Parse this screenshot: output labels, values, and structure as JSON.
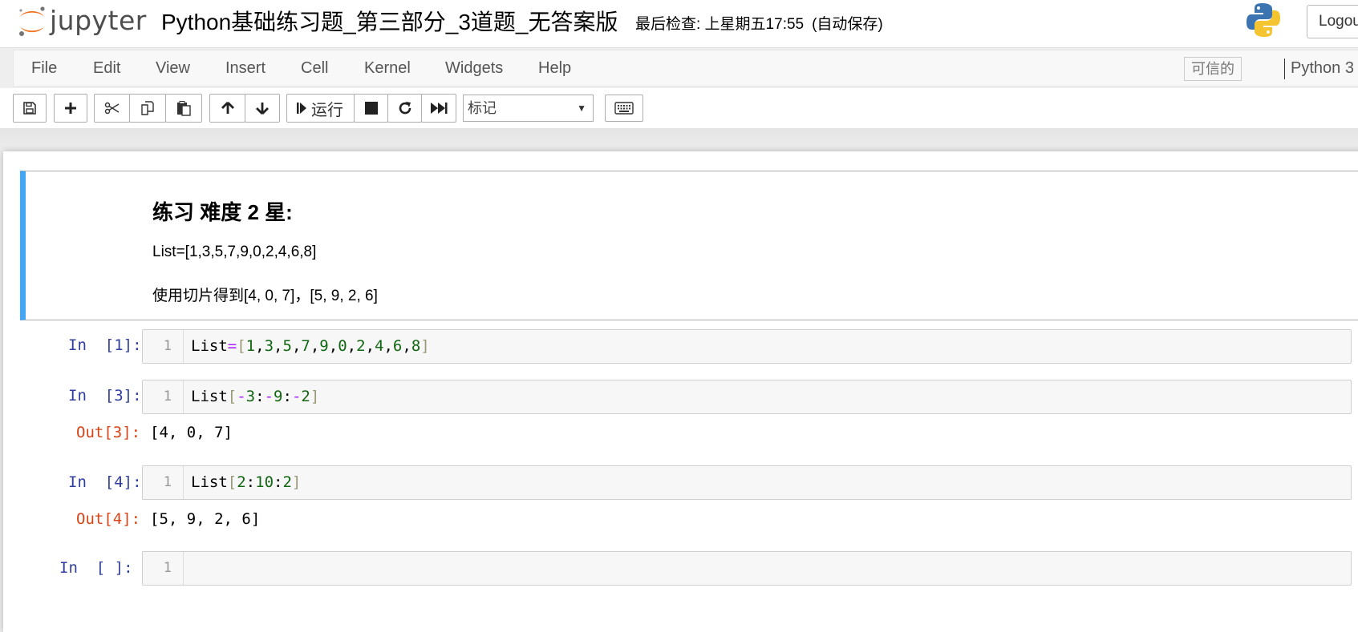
{
  "header": {
    "logo_text": "jupyter",
    "notebook_title": "Python基础练习题_第三部分_3道题_无答案版",
    "checkpoint": "最后检查: 上星期五17:55",
    "autosave": "(自动保存)",
    "logout_label": "Logout"
  },
  "menubar": {
    "items": [
      "File",
      "Edit",
      "View",
      "Insert",
      "Cell",
      "Kernel",
      "Widgets",
      "Help"
    ],
    "trusted": "可信的",
    "kernel": "Python 3"
  },
  "toolbar": {
    "run_label": "运行",
    "cell_type": "标记",
    "icons": [
      "save-icon",
      "plus-icon",
      "cut-icon",
      "copy-icon",
      "paste-icon",
      "arrow-up-icon",
      "arrow-down-icon",
      "step-forward-icon",
      "stop-icon",
      "restart-icon",
      "fast-forward-icon",
      "keyboard-icon"
    ]
  },
  "markdown_cell": {
    "heading": "练习 难度 2 星:",
    "line1": "List=[1,3,5,7,9,0,2,4,6,8]",
    "line2": "使用切片得到[4, 0, 7]，[5, 9, 2, 6]"
  },
  "code_cells": [
    {
      "prompt": "In  [1]:",
      "line_number": "1",
      "tokens": [
        [
          "n",
          "List"
        ],
        [
          "o",
          "="
        ],
        [
          "b",
          "["
        ],
        [
          "d",
          "1"
        ],
        [
          "p",
          ","
        ],
        [
          "d",
          "3"
        ],
        [
          "p",
          ","
        ],
        [
          "d",
          "5"
        ],
        [
          "p",
          ","
        ],
        [
          "d",
          "7"
        ],
        [
          "p",
          ","
        ],
        [
          "d",
          "9"
        ],
        [
          "p",
          ","
        ],
        [
          "d",
          "0"
        ],
        [
          "p",
          ","
        ],
        [
          "d",
          "2"
        ],
        [
          "p",
          ","
        ],
        [
          "d",
          "4"
        ],
        [
          "p",
          ","
        ],
        [
          "d",
          "6"
        ],
        [
          "p",
          ","
        ],
        [
          "d",
          "8"
        ],
        [
          "b",
          "]"
        ]
      ]
    },
    {
      "prompt": "In  [3]:",
      "line_number": "1",
      "tokens": [
        [
          "n",
          "List"
        ],
        [
          "b",
          "["
        ],
        [
          "o",
          "-"
        ],
        [
          "d",
          "3"
        ],
        [
          "p",
          ":"
        ],
        [
          "o",
          "-"
        ],
        [
          "d",
          "9"
        ],
        [
          "p",
          ":"
        ],
        [
          "o",
          "-"
        ],
        [
          "d",
          "2"
        ],
        [
          "b",
          "]"
        ]
      ],
      "out_prompt": "Out[3]:",
      "output": "[4, 0, 7]"
    },
    {
      "prompt": "In  [4]:",
      "line_number": "1",
      "tokens": [
        [
          "n",
          "List"
        ],
        [
          "b",
          "["
        ],
        [
          "d",
          "2"
        ],
        [
          "p",
          ":"
        ],
        [
          "d",
          "10"
        ],
        [
          "p",
          ":"
        ],
        [
          "d",
          "2"
        ],
        [
          "b",
          "]"
        ]
      ],
      "out_prompt": "Out[4]:",
      "output": "[5, 9, 2, 6]"
    },
    {
      "prompt": "In  [ ]:",
      "line_number": "1",
      "tokens": []
    }
  ],
  "colors": {
    "selected_cell_bar": "#42a5f5",
    "in_prompt": "#303f9f",
    "out_prompt": "#d84315",
    "number": "#116611",
    "operator": "#aa22ff",
    "bracket": "#999977"
  }
}
